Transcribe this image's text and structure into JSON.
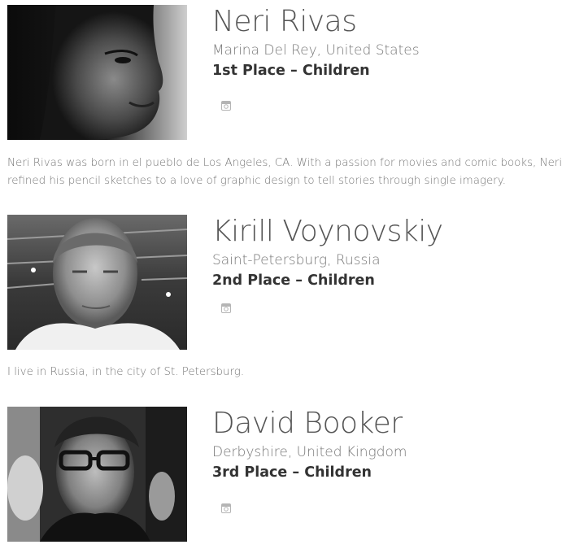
{
  "winners": [
    {
      "name": "Neri Rivas",
      "location": "Marina Del Rey, United States",
      "place": "1st Place – Children",
      "social_icon": "instagram-icon",
      "bio": "Neri Rivas was born in el pueblo de Los Angeles, CA. With a passion for movies and comic books, Neri refined his pencil sketches to a love of graphic design to tell stories through single imagery."
    },
    {
      "name": "Kirill Voynovskiy",
      "location": "Saint-Petersburg, Russia",
      "place": "2nd Place – Children",
      "social_icon": "instagram-icon",
      "bio": "I live in Russia, in the city of St. Petersburg."
    },
    {
      "name": "David Booker",
      "location": "Derbyshire, United Kingdom",
      "place": "3rd Place – Children",
      "social_icon": "instagram-icon",
      "bio": ""
    }
  ],
  "colors": {
    "name": "#555555",
    "location": "#777777",
    "place": "#333333",
    "bio": "#777777",
    "icon": "#b5b5b5"
  }
}
